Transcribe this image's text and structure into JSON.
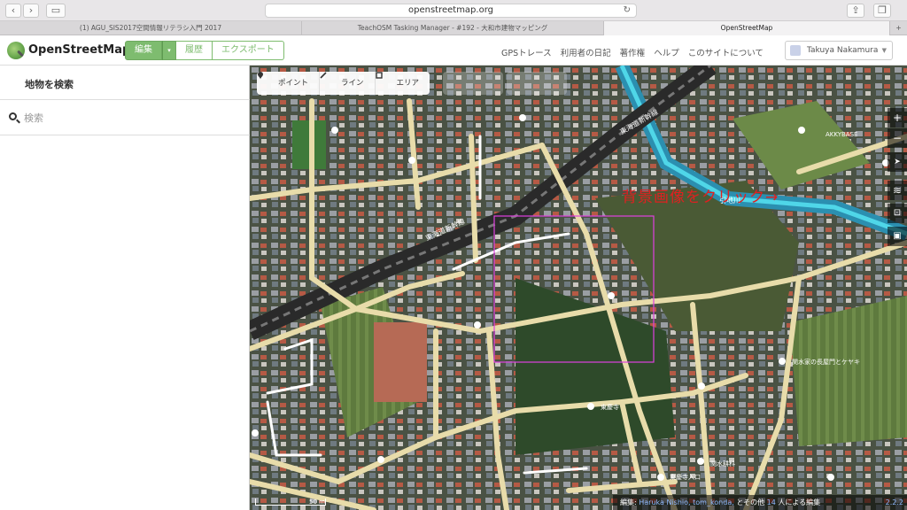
{
  "browser": {
    "url": "openstreetmap.org",
    "tabs": [
      {
        "label": "(1) AGU_SIS2017空間情報リテラシ入門 2017"
      },
      {
        "label": "TeachOSM Tasking Manager - #192 - 大和市建物マッピング"
      },
      {
        "label": "OpenStreetMap"
      }
    ]
  },
  "header": {
    "brand": "OpenStreetMap",
    "edit_label": "編集",
    "dropdown_label": "▾",
    "history_label": "履歴",
    "export_label": "エクスポート",
    "links": [
      "GPSトレース",
      "利用者の日記",
      "著作権",
      "ヘルプ",
      "このサイトについて"
    ],
    "user_name": "Takuya Nakamura"
  },
  "sidebar": {
    "title": "地物を検索",
    "search_placeholder": "検索"
  },
  "map": {
    "modes": [
      {
        "label": "ポイント",
        "icon": "point-icon"
      },
      {
        "label": "ライン",
        "icon": "line-icon"
      },
      {
        "label": "エリア",
        "icon": "area-icon"
      }
    ],
    "controls": [
      "+",
      "−",
      "➤",
      "≋",
      "⊡",
      "▣"
    ],
    "annotation": "背景画像をクリック→",
    "labels": {
      "railway1": "東海道新幹線",
      "railway2": "東海道新幹線",
      "river": "引地川",
      "poi1": "AKKYBASE",
      "poi2": "関水家の長屋門とケヤキ",
      "poi3": "関水耕科",
      "poi4": "東慶寺入口",
      "poi5": "東慶寺"
    },
    "scale_label": "50 m",
    "attribution_prefix": "編集: ",
    "attribution_users": "Haruka Nishio, tom_konda,",
    "attribution_middle": " とその他 ",
    "attribution_count": "14",
    "attribution_suffix": " 人による編集",
    "version": "2.2.2"
  },
  "colors": {
    "accent": "#7ebc6f",
    "selection": "#e040e0",
    "annotation": "#e02020",
    "road": "#e8dcaa"
  }
}
